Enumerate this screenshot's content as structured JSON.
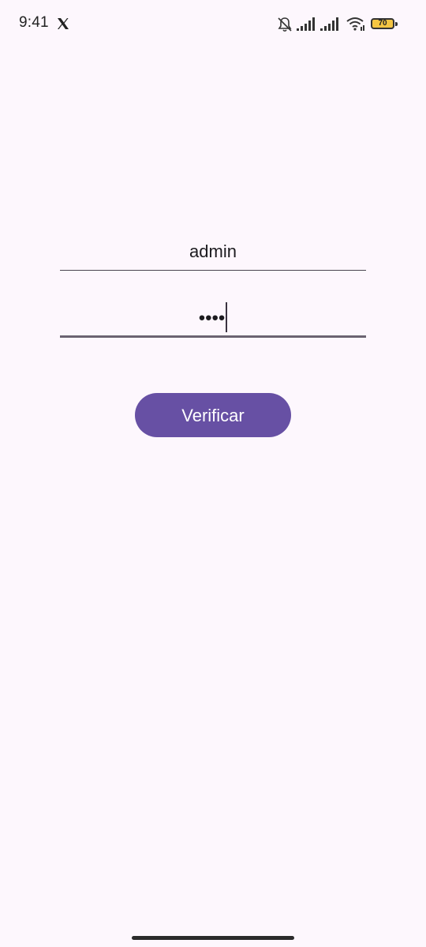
{
  "status_bar": {
    "time": "9:41",
    "battery_level": "70",
    "icons": [
      "x-logo-icon",
      "bell-off-icon",
      "signal-1-icon",
      "signal-2-icon",
      "wifi-icon",
      "battery-icon"
    ]
  },
  "login": {
    "username_value": "admin",
    "password_masked": "••••",
    "password_length": 4,
    "verify_label": "Verificar"
  },
  "colors": {
    "background": "#fdf7fd",
    "primary": "#6750a4",
    "on_primary": "#ffffff",
    "underline": "#49454f"
  }
}
